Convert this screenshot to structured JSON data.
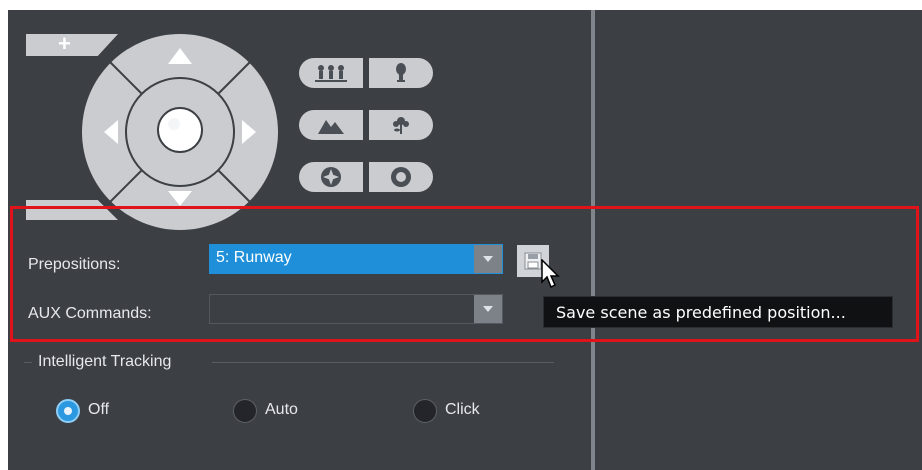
{
  "zoom": {
    "in_label": "+",
    "out_label": "−"
  },
  "ptz": {
    "icons": [
      "arrow-up-icon",
      "arrow-left-icon",
      "arrow-right-icon",
      "arrow-down-icon",
      "home-icon"
    ],
    "buttons": [
      {
        "name": "wide-view-button",
        "icon": "multiple-people-icon"
      },
      {
        "name": "tele-view-button",
        "icon": "single-person-icon"
      },
      {
        "name": "far-focus-button",
        "icon": "mountain-icon"
      },
      {
        "name": "near-focus-button",
        "icon": "flower-icon"
      },
      {
        "name": "iris-close-button",
        "icon": "iris-closed-icon"
      },
      {
        "name": "iris-open-button",
        "icon": "iris-open-icon"
      }
    ]
  },
  "prepositions": {
    "label": "Prepositions:",
    "value": "5: Runway"
  },
  "aux": {
    "label": "AUX Commands:",
    "value": ""
  },
  "tooltip": "Save scene as predefined position...",
  "tracking": {
    "title": "Intelligent Tracking",
    "options": [
      {
        "label": "Off",
        "checked": true
      },
      {
        "label": "Auto",
        "checked": false
      },
      {
        "label": "Click",
        "checked": false
      }
    ]
  },
  "colors": {
    "panel": "#3c3f44",
    "control": "#caccd0",
    "selection": "#1e8fd8",
    "highlight": "#e0121a"
  }
}
